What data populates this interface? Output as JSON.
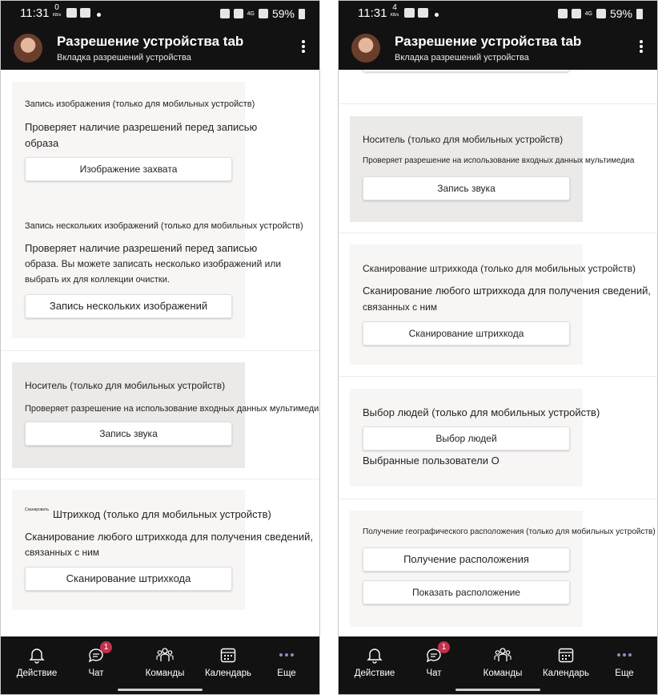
{
  "status": {
    "time": "11:31",
    "kbs_left": "0",
    "kbs_right": "4",
    "kbs_unit": "KB/s",
    "network": "4G",
    "battery": "59%"
  },
  "header": {
    "title": "Разрешение устройства tab",
    "subtitle": "Вкладка разрешений устройства"
  },
  "left": {
    "capture_image": {
      "title": "Запись изображения (только для мобильных устройств)",
      "desc_line1": "Проверяет наличие разрешений перед записью",
      "desc_line2": "образа",
      "button": "Изображение захвата"
    },
    "capture_multiple": {
      "title": "Запись нескольких изображений (только для мобильных устройств)",
      "desc_line1": "Проверяет наличие разрешений перед записью",
      "desc_line2": "образа. Вы можете записать несколько изображений или",
      "desc_line3": "выбрать их для коллекции очистки.",
      "button": "Запись нескольких изображений"
    },
    "media": {
      "title": "Носитель (только для мобильных устройств)",
      "desc": "Проверяет разрешение на использование входных данных мультимедиа",
      "button": "Запись звука"
    },
    "barcode": {
      "tiny_label": "Сканировать",
      "title": "Штрихкод (только для мобильных устройств)",
      "desc_line1": "Сканирование любого штрихкода для получения сведений,",
      "desc_line2": "связанных с ним",
      "button": "Сканирование штрихкода"
    }
  },
  "right": {
    "media": {
      "title": "Носитель (только для мобильных устройств)",
      "desc": "Проверяет разрешение на использование входных данных мультимедиа",
      "button": "Запись звука"
    },
    "barcode": {
      "title": "Сканирование штрихкода (только для мобильных устройств)",
      "desc_line1": "Сканирование любого штрихкода для получения сведений,",
      "desc_line2": "связанных с ним",
      "button": "Сканирование штрихкода"
    },
    "people": {
      "title": "Выбор людей (только для мобильных устройств)",
      "button": "Выбор людей",
      "selected": "Выбранные пользователи О"
    },
    "location": {
      "title": "Получение географического расположения (только для мобильных устройств)",
      "button_get": "Получение расположения",
      "button_show": "Показать расположение"
    }
  },
  "tabs": {
    "activity": "Действие",
    "chat": "Чат",
    "chat_badge": "1",
    "teams": "Команды",
    "calendar": "Календарь",
    "more": "Еще"
  },
  "icons": {
    "activity": "bell-icon",
    "chat": "chat-icon",
    "teams": "teams-icon",
    "calendar": "calendar-icon",
    "more": "more-dots-icon"
  },
  "colors": {
    "bar_bg": "#121212",
    "card_bg": "#f7f6f5",
    "card_active_bg": "#ebeae9",
    "badge": "#c4314b",
    "more_accent": "#8b8cc7"
  }
}
